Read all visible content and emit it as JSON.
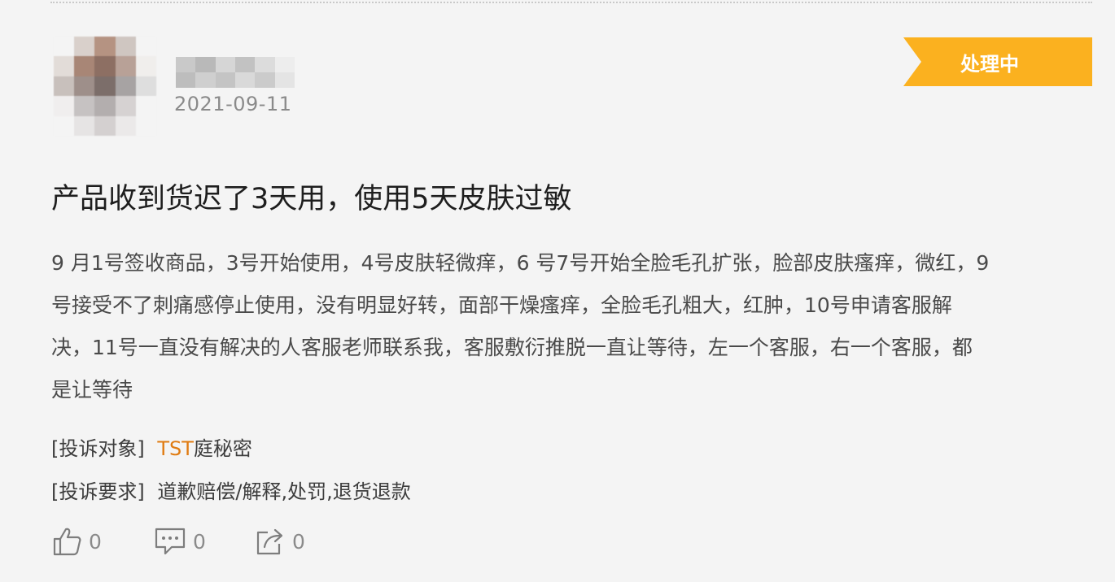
{
  "post": {
    "date": "2021-09-11",
    "status": "处理中",
    "title": "产品收到货迟了3天用，使用5天皮肤过敏",
    "body_lines": [
      "9 月1号签收商品，3号开始使用，4号皮肤轻微痒，6 号7号开始全脸毛孔扩张，脸部皮肤瘙痒，微红，9",
      "号接受不了刺痛感停止使用，没有明显好转，面部干燥瘙痒，全脸毛孔粗大，红肿，10号申请客服解",
      "决，11号一直没有解决的人客服老师联系我，客服敷衍推脱一直让等待，左一个客服，右一个客服，都",
      "是让等待"
    ]
  },
  "complaint": {
    "target_label": "[投诉对象]",
    "target_link": "TST",
    "target_suffix": "庭秘密",
    "request_label": "[投诉要求]",
    "request_value": "道歉赔偿/解释,处罚,退货退款"
  },
  "actions": {
    "like_count": "0",
    "comment_count": "0",
    "share_count": "0"
  },
  "icons": {
    "like": "thumbs-up-icon",
    "comment": "comment-icon",
    "share": "share-icon"
  },
  "colors": {
    "status_badge": "#fbb11f",
    "link": "#e07b11"
  }
}
